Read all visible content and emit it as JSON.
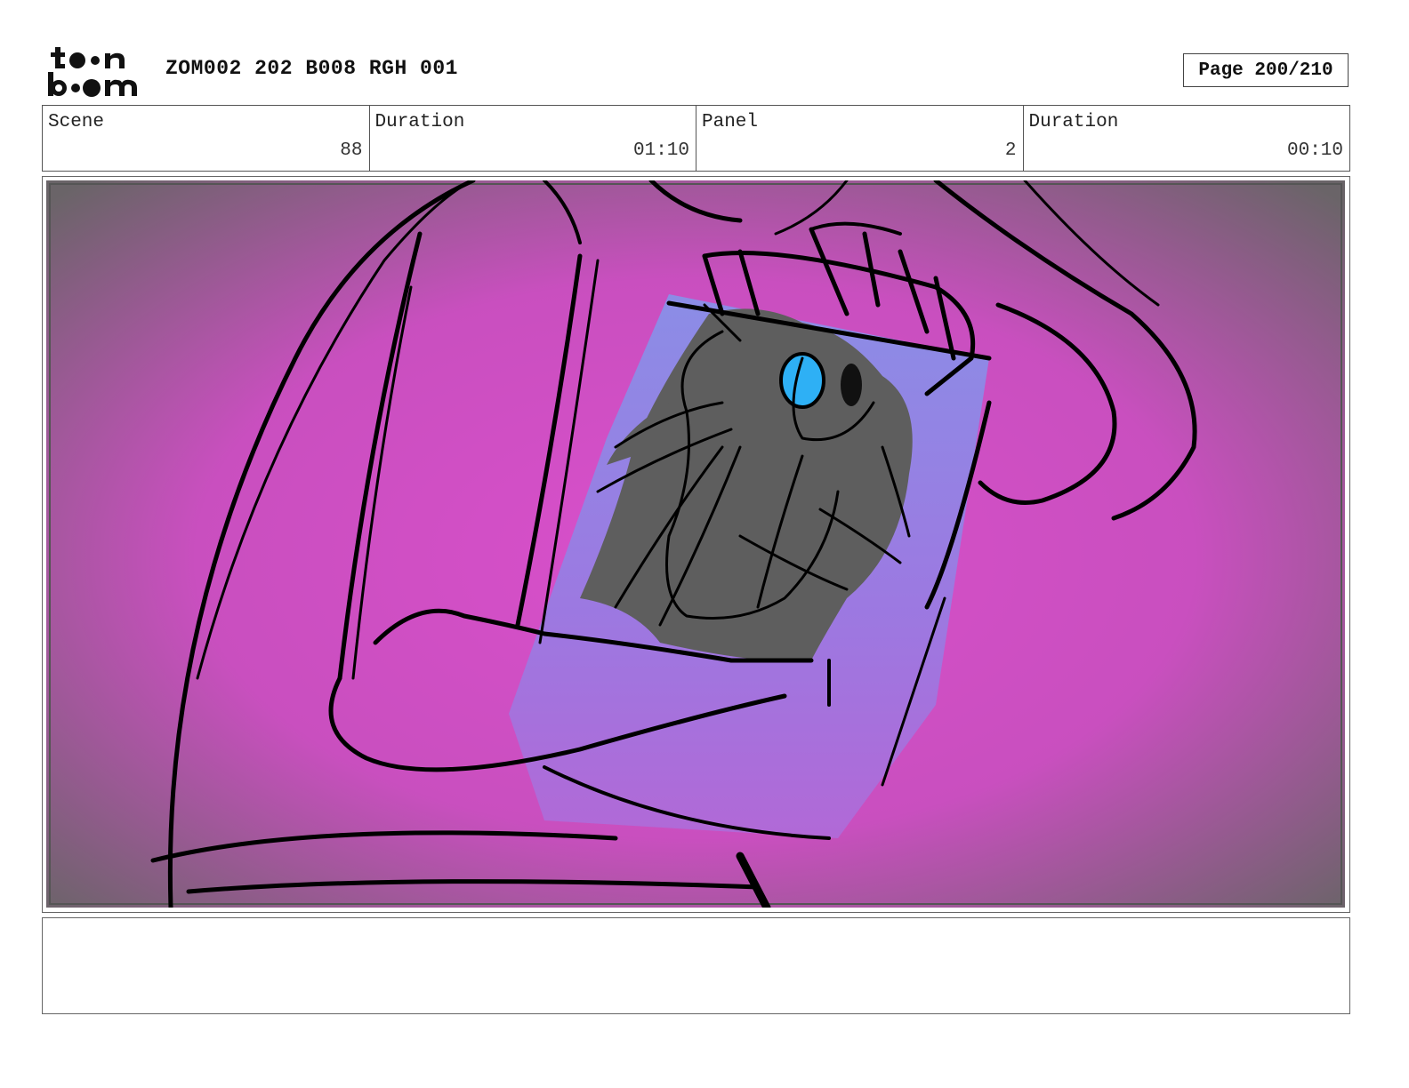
{
  "header": {
    "logo_text": "toon boom",
    "title": "ZOM002 202 B008 RGH 001",
    "page": "Page 200/210"
  },
  "info": {
    "scene_label": "Scene",
    "scene_value": "88",
    "scene_duration_label": "Duration",
    "scene_duration_value": "01:10",
    "panel_label": "Panel",
    "panel_value": "2",
    "panel_duration_label": "Duration",
    "panel_duration_value": "00:10"
  },
  "panel": {
    "colors": {
      "background_center": "#d94fcb",
      "background_edge": "#6a6468",
      "screen": "#8c7fe6",
      "creature": "#5e5e5e",
      "eye": "#2eb0f5",
      "ink": "#000000"
    }
  },
  "notes": {
    "text": ""
  }
}
